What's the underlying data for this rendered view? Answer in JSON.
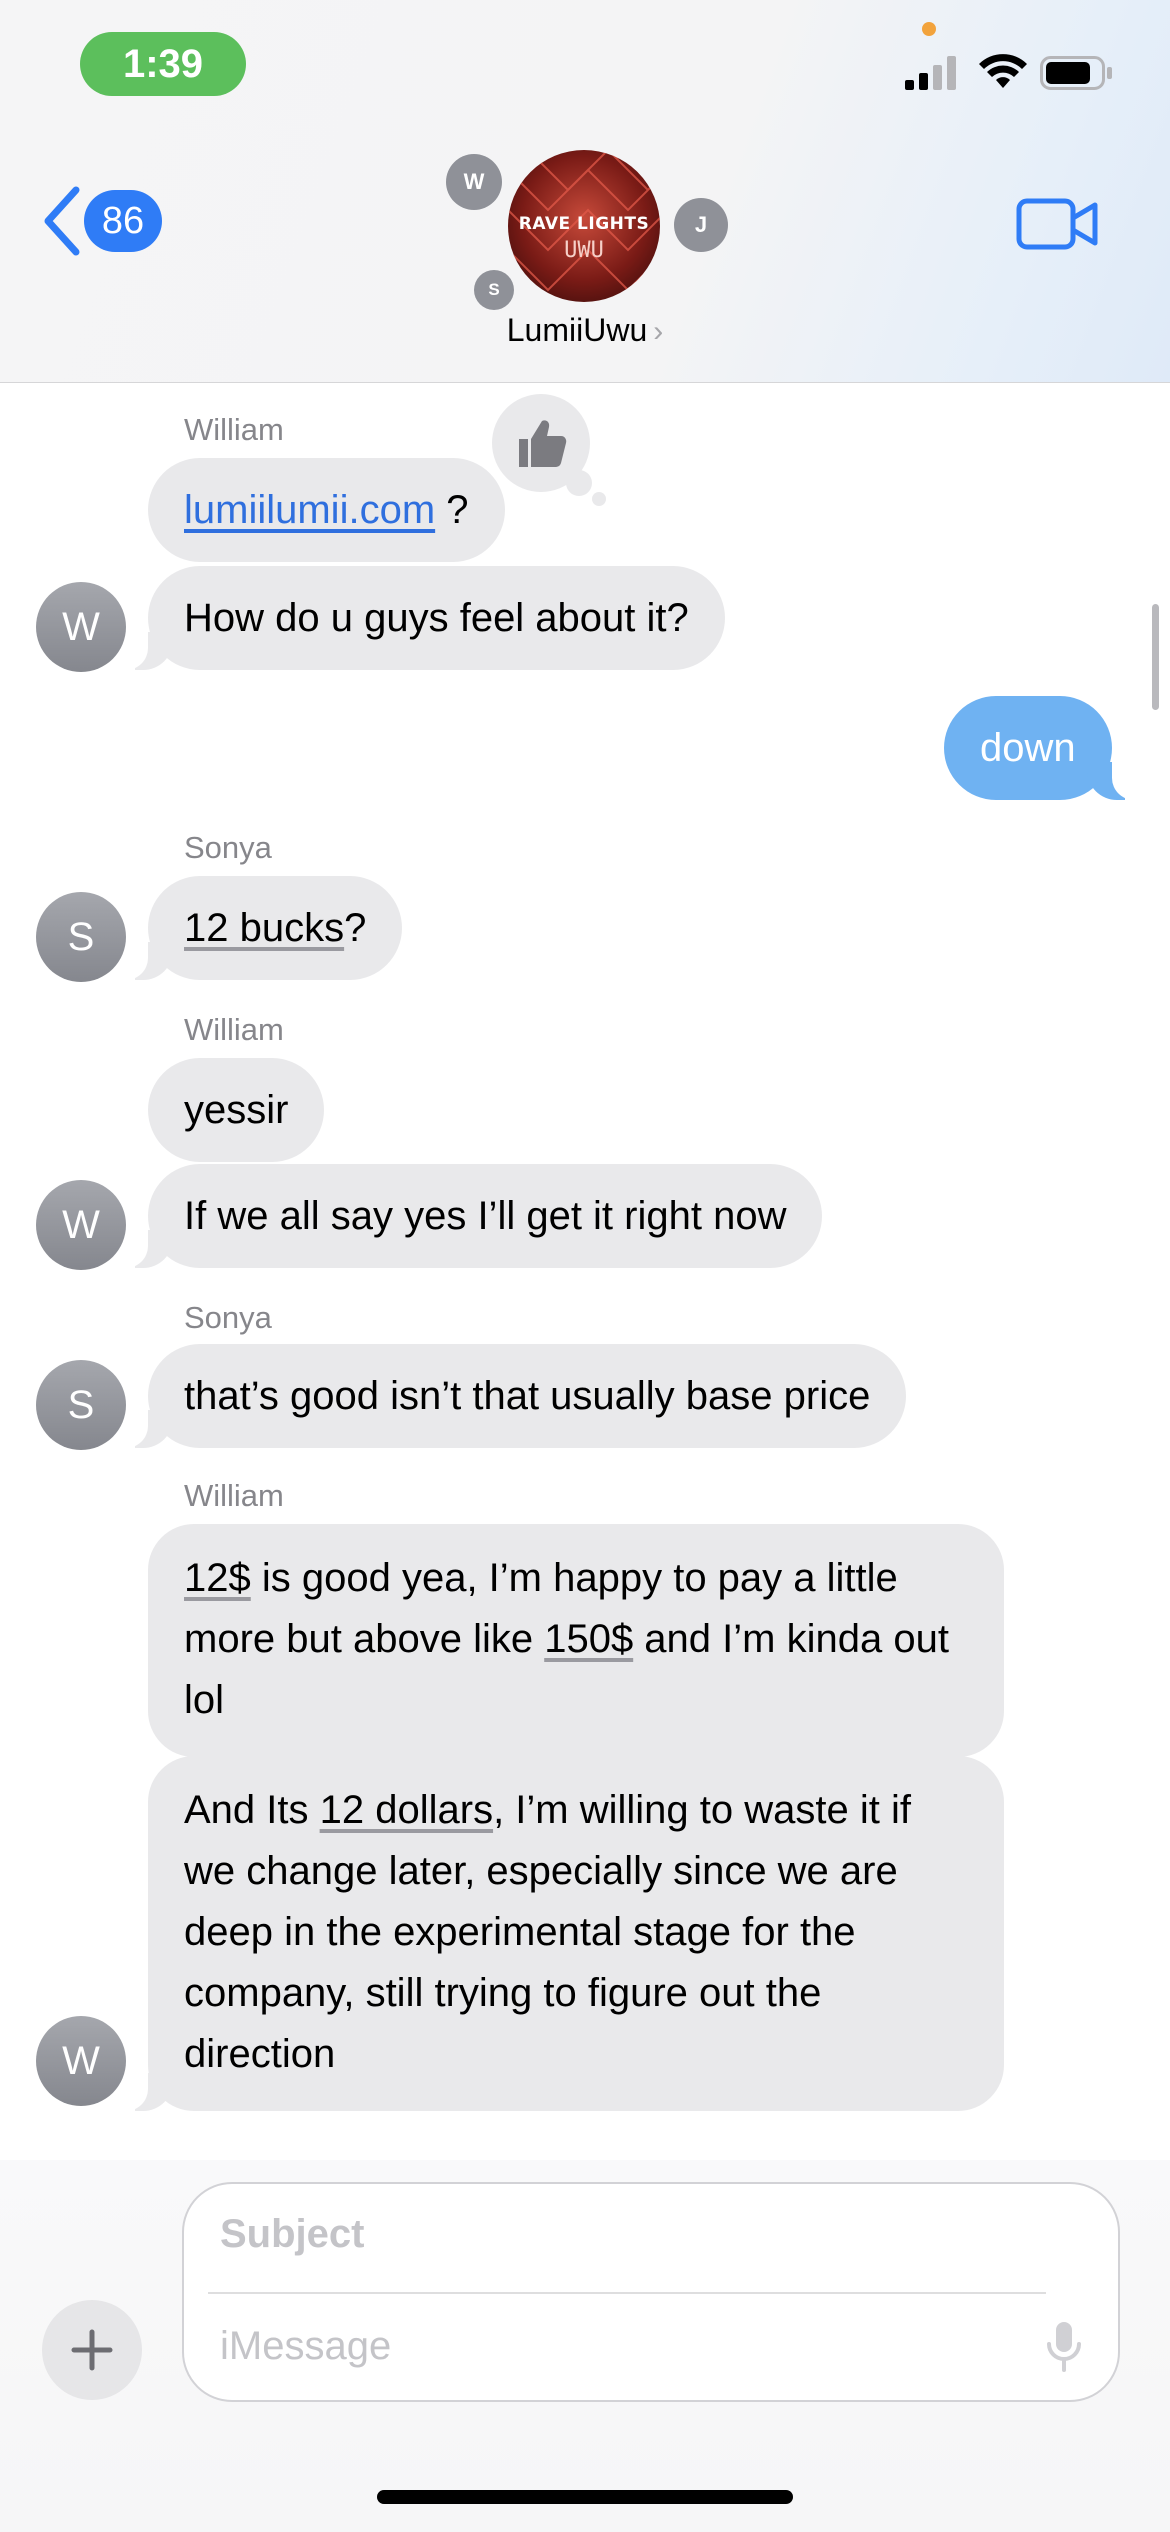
{
  "status_bar": {
    "time": "1:39"
  },
  "header": {
    "back_count": "86",
    "group_name": "LumiiUwu",
    "group_name_chevron": "›",
    "avatar_text_top": "RAVE LIGHTS",
    "avatar_text_bottom": "UWU",
    "member_initials": [
      "W",
      "J",
      "S"
    ],
    "icons": [
      "back-chevron-icon",
      "video-camera-icon"
    ]
  },
  "messages": {
    "m1": {
      "sender": "William",
      "text_link": "lumiilumii.com",
      "text_rest": " ?",
      "reaction": "thumbs-up-icon"
    },
    "m2": {
      "text": "How do u guys feel about it?",
      "avatar": "W"
    },
    "m3": {
      "text": "down"
    },
    "m4": {
      "sender": "Sonya",
      "text_u": "12 bucks",
      "text_rest": "?",
      "avatar": "S"
    },
    "m5": {
      "sender": "William",
      "text": "yessir"
    },
    "m6": {
      "text": "If we all say yes I’ll get it right now",
      "avatar": "W"
    },
    "m7": {
      "sender": "Sonya",
      "text": "that’s good isn’t that usually base price",
      "avatar": "S"
    },
    "m8": {
      "sender": "William",
      "p1_u": "12$",
      "p2": " is good yea, I’m happy to pay a little more but above like ",
      "p3_u": "150$",
      "p4": " and I’m kinda out lol"
    },
    "m9": {
      "p1": "And Its ",
      "p2_u": "12 dollars",
      "p3": ", I’m willing to waste it if we change later, especially since we are deep in the experimental stage for the company, still trying to figure out the direction",
      "avatar": "W"
    }
  },
  "composer": {
    "subject_placeholder": "Subject",
    "message_placeholder": "iMessage",
    "icons": [
      "plus-icon",
      "microphone-icon"
    ]
  },
  "colors": {
    "accent_blue": "#2f7cf6",
    "sent_bubble": "#6fb2f2",
    "received_bubble": "#e9e9eb",
    "time_pill": "#5cbf5c"
  }
}
